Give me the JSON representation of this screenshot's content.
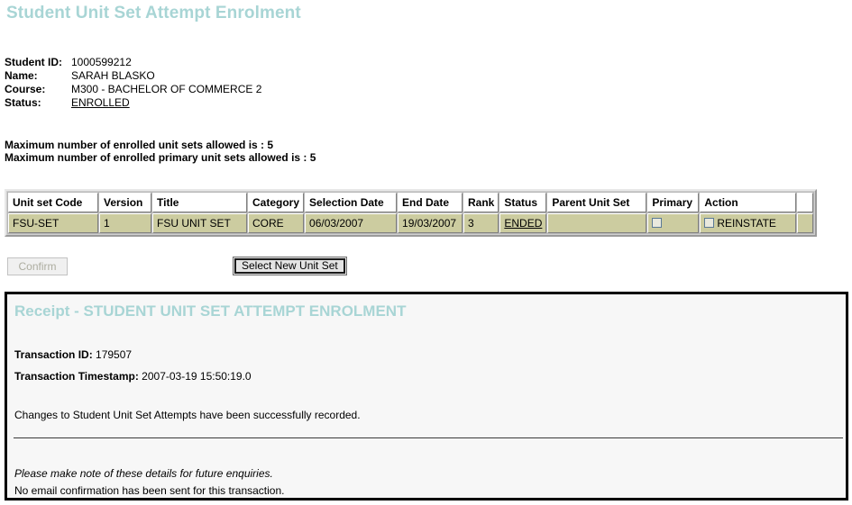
{
  "page": {
    "title": "Student Unit Set Attempt Enrolment",
    "title_color": "#a8d5d5"
  },
  "student": {
    "id_label": "Student ID:",
    "id_value": "1000599212",
    "name_label": "Name:",
    "name_value": "SARAH BLASKO",
    "course_label": "Course:",
    "course_value": "M300 - BACHELOR OF COMMERCE 2",
    "status_label": "Status:",
    "status_value": "ENROLLED"
  },
  "limits": {
    "line1": "Maximum number of enrolled unit sets allowed is : 5",
    "line2": "Maximum number of enrolled primary unit sets allowed is : 5"
  },
  "unitset_table": {
    "headers": [
      "Unit set Code",
      "Version",
      "Title",
      "Category",
      "Selection Date",
      "End Date",
      "Rank",
      "Status",
      "Parent Unit Set",
      "Primary",
      "Action",
      ""
    ],
    "rows": [
      {
        "code": "FSU-SET",
        "version": "1",
        "title": "FSU UNIT SET",
        "category": "CORE",
        "selection_date": "06/03/2007",
        "end_date": "19/03/2007",
        "rank": "3",
        "status": "ENDED",
        "parent_unit_set": "",
        "primary_checked": false,
        "action_label": "REINSTATE",
        "action_checked": false,
        "pad": ""
      }
    ],
    "row_color": "#ccccA0"
  },
  "buttons": {
    "confirm": "Confirm",
    "select_new_unit_set": "Select New Unit Set"
  },
  "receipt": {
    "title_strong": "Receipt - ",
    "title_rest": "STUDENT UNIT SET ATTEMPT ENROLMENT",
    "transaction_id_label": "Transaction ID:",
    "transaction_id_value": "179507",
    "timestamp_label": "Transaction Timestamp:",
    "timestamp_value": "2007-03-19 15:50:19.0",
    "message": "Changes to Student Unit Set Attempts have been successfully recorded.",
    "note": "Please make note of these details for future enquiries.",
    "email_note": "No email confirmation has been sent for this transaction."
  }
}
